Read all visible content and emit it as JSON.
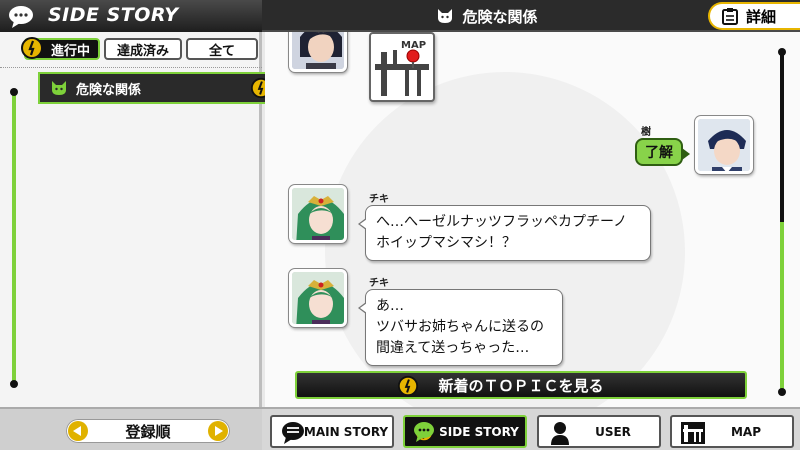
{
  "header": {
    "app_title": "SIDE STORY",
    "topic_title": "危険な関係",
    "detail_label": "詳細"
  },
  "tabs": [
    {
      "label": "進行中",
      "active": true
    },
    {
      "label": "達成済み",
      "active": false
    },
    {
      "label": "全て",
      "active": false
    }
  ],
  "topic_list": [
    {
      "label": "危険な関係",
      "icon": "cat-icon",
      "alert": true
    }
  ],
  "chat": {
    "messages": [
      {
        "speaker": "",
        "type": "image",
        "image_label": "MAP"
      },
      {
        "speaker": "樹",
        "type": "reply",
        "text": "了解"
      },
      {
        "speaker": "チキ",
        "type": "text",
        "lines": [
          "へ…へーゼルナッツフラッペカプチーノ",
          "ホイップマシマシ！？"
        ]
      },
      {
        "speaker": "チキ",
        "type": "text",
        "lines": [
          "あ…",
          "ツバサお姉ちゃんに送るの",
          "間違えて送っちゃった…"
        ]
      }
    ],
    "new_topic_label": "新着のＴＯＰＩＣを見る"
  },
  "sort": {
    "label": "登録順"
  },
  "nav": [
    {
      "label": "MAIN STORY",
      "icon": "speech-bubble-icon",
      "active": false
    },
    {
      "label": "SIDE STORY",
      "icon": "chat-bubbles-icon",
      "active": true
    },
    {
      "label": "USER",
      "icon": "person-icon",
      "active": false
    },
    {
      "label": "MAP",
      "icon": "map-icon",
      "active": false
    }
  ],
  "colors": {
    "accent_green": "#7ed13a",
    "alert_yellow": "#e7b500",
    "dark": "#111111"
  }
}
